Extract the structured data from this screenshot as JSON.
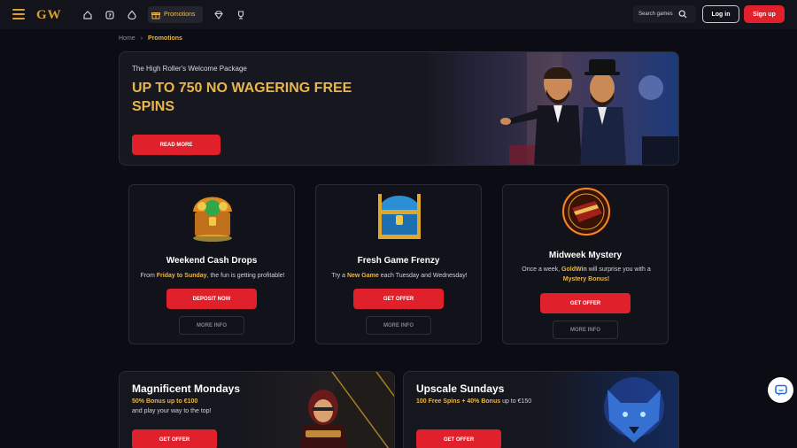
{
  "header": {
    "logo_text": "GW",
    "promotions_label": "Promotions",
    "search_label": "Search games",
    "login_label": "Log in",
    "signup_label": "Sign up"
  },
  "breadcrumb": {
    "home": "Home",
    "separator": "›",
    "current": "Promotions"
  },
  "hero": {
    "subtitle": "The High Roller's Welcome Package",
    "title": "UP TO 750 NO WAGERING FREE SPINS",
    "button": "READ MORE"
  },
  "cards": [
    {
      "title": "Weekend Cash Drops",
      "desc_before": "From ",
      "desc_highlight": "Friday to Sunday",
      "desc_after": ", the fun is getting profitable!",
      "primary": "DEPOSIT NOW",
      "secondary": "MORE INFO"
    },
    {
      "title": "Fresh Game Frenzy",
      "desc_before": "Try a ",
      "desc_highlight": "New Game",
      "desc_after": " each Tuesday and Wednesday!",
      "primary": "GET OFFER",
      "secondary": "MORE INFO"
    },
    {
      "title": "Midweek Mystery",
      "desc_before": "Once a week, ",
      "desc_highlight": "GoldWin",
      "desc_after": " will surprise you with a",
      "desc_highlight2": "Mystery Bonus!",
      "primary": "GET OFFER",
      "secondary": "MORE INFO"
    }
  ],
  "banners": [
    {
      "title": "Magnificent Mondays",
      "line1_highlight": "50% Bonus up to €100",
      "line2": "and play your way to the top!",
      "button": "GET OFFER"
    },
    {
      "title": "Upscale Sundays",
      "line1_highlight": "100 Free Spins + 40% Bonus",
      "line1_rest": " up to €150",
      "button": "GET OFFER"
    }
  ],
  "colors": {
    "accent_gold": "#e8b64a",
    "primary_red": "#e0202a",
    "background": "#0c0d14"
  }
}
